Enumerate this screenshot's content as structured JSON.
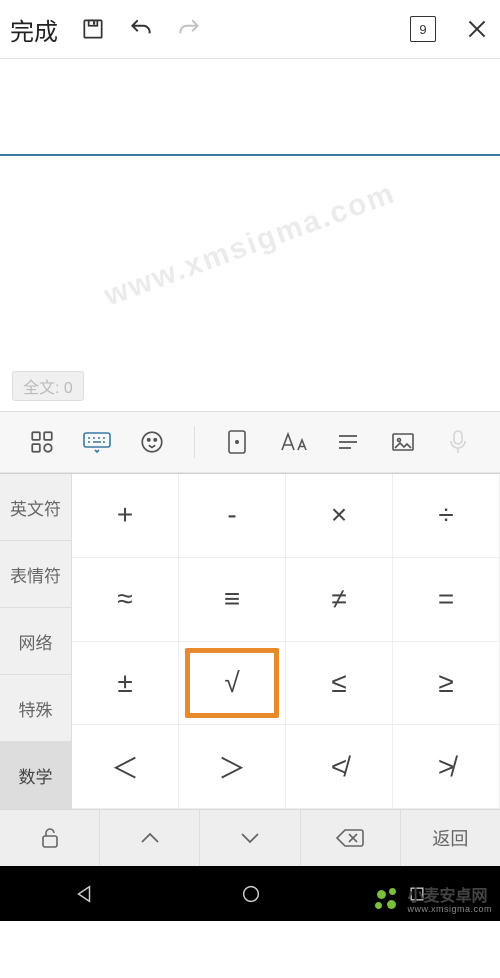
{
  "toolbar": {
    "done_label": "完成",
    "page_number": "9"
  },
  "word_count": {
    "label": "全文: 0"
  },
  "keyboard": {
    "categories": [
      "英文符",
      "表情符",
      "网络",
      "特殊",
      "数学"
    ],
    "selected_category_index": 4,
    "grid": [
      [
        "+",
        "-",
        "×",
        "÷"
      ],
      [
        "≈",
        "≡",
        "≠",
        "="
      ],
      [
        "±",
        "√",
        "≤",
        "≥"
      ],
      [
        "＜",
        "＞",
        "≮",
        "≯"
      ]
    ],
    "highlighted": [
      2,
      1
    ],
    "func_row": {
      "back_label": "返回"
    }
  },
  "watermark": {
    "diagonal": "www.xmsigma.com"
  },
  "footer_logo": {
    "cn": "小麦安卓网",
    "en": "www.xmsigma.com"
  }
}
